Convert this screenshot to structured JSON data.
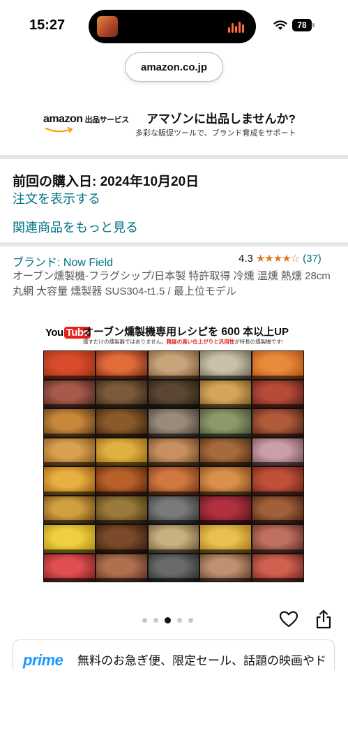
{
  "status_bar": {
    "time": "15:27",
    "battery": "78"
  },
  "browser": {
    "url": "amazon.co.jp"
  },
  "sell_banner": {
    "logo": "amazon",
    "logo_sub": "出品サービス",
    "title": "アマゾンに出品しませんか?",
    "subtitle": "多彩な販促ツールで、ブランド育成をサポート"
  },
  "purchase": {
    "last_purchase": "前回の購入日: 2024年10月20日",
    "view_order": "注文を表示する",
    "see_related": "関連商品をもっと見る"
  },
  "product": {
    "brand": "ブランド: Now Field",
    "rating": "4.3",
    "stars": "★★★★☆",
    "rating_count": "(37)",
    "title": "オーブン燻製機-フラグシップ/日本製 特許取得 冷燻 温燻 熱燻 28cm丸網 大容量 燻製器 SUS304-t1.5 / 最上位モデル"
  },
  "product_image": {
    "logo_you": "You",
    "logo_tube": "Tube",
    "headline_pre": "オーブン燻製機専用レシピを",
    "headline_num": "600",
    "headline_post": "本以上UP",
    "tagline_pre": "燻すだけの燻製器ではありません。",
    "tagline_red": "精度の高い仕上がりと汎用性",
    "tagline_post": "が特長の燻製機です!"
  },
  "carousel": {
    "count": 5,
    "active_index": 2
  },
  "prime": {
    "logo": "prime",
    "text": "無料のお急ぎ便、限定セール、話題の映画やドラマ見放題などの特典が"
  },
  "icons": [
    "wifi-icon",
    "heart-icon",
    "share-icon"
  ],
  "colors": {
    "link": "#007185",
    "star": "#de7921",
    "prime": "#1a98ff"
  }
}
